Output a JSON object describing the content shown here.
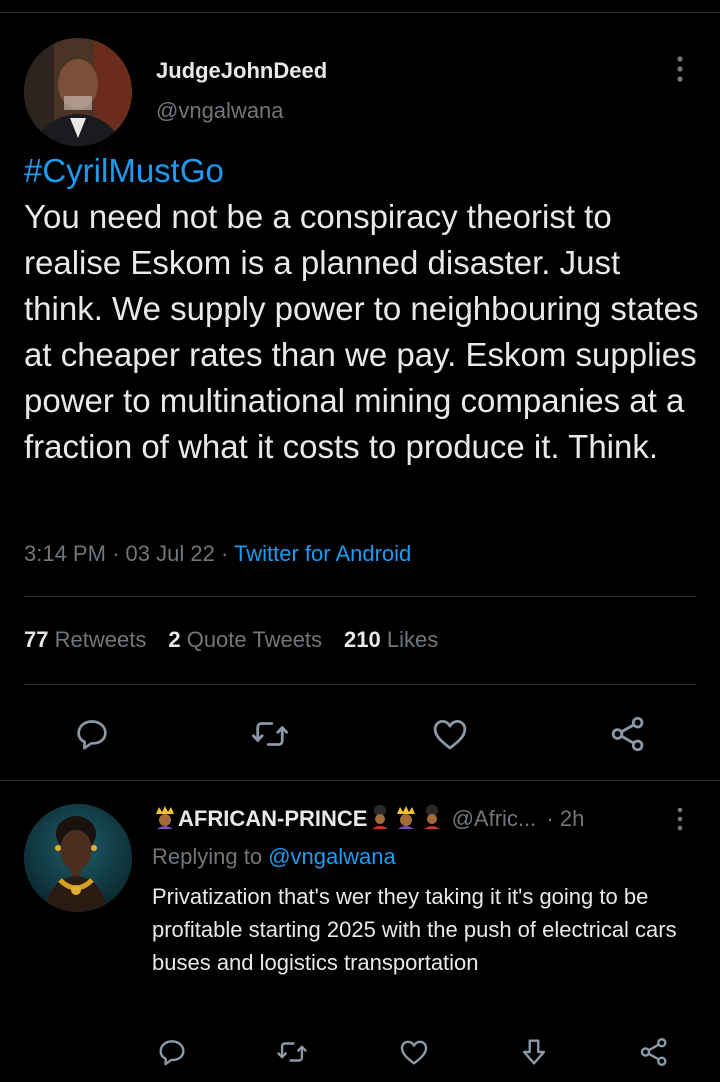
{
  "tweet": {
    "author_name": "JudgeJohnDeed",
    "author_handle": "@vngalwana",
    "hashtag": "#CyrilMustGo",
    "body": "You need not be a conspiracy theorist to realise Eskom is a planned disaster. Just think. We supply power to neighbouring states at cheaper rates than we pay. Eskom supplies power to multinational mining companies at a fraction of what it costs to produce it. Think.",
    "time": "3:14 PM",
    "date": "03 Jul 22",
    "sep": "·",
    "source": "Twitter for Android",
    "stats": {
      "retweets_count": "77",
      "retweets_label": "Retweets",
      "quotes_count": "2",
      "quotes_label": "Quote Tweets",
      "likes_count": "210",
      "likes_label": "Likes"
    }
  },
  "reply": {
    "author_name": "AFRICAN-PRINCE",
    "author_handle": "@Afric...",
    "sep": "·",
    "age": "2h",
    "replying_label": "Replying to",
    "replying_to": "@vngalwana",
    "body": "Privatization that's wer they taking it it's going to be profitable starting 2025 with the push of electrical cars buses and logistics transportation"
  },
  "icons": {
    "reply": "comment-icon",
    "retweet": "retweet-icon",
    "like": "heart-icon",
    "share": "share-icon",
    "download": "download-icon",
    "more": "more-vertical-icon"
  },
  "colors": {
    "background": "#000000",
    "text": "#e7e9ea",
    "secondary": "#71767b",
    "accent": "#1d9bf0",
    "divider": "#2f3336"
  }
}
